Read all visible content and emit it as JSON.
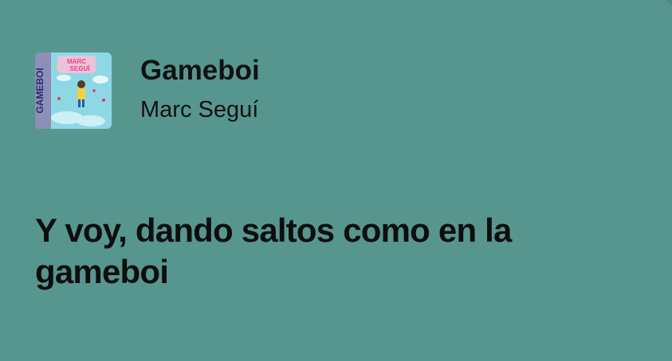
{
  "colors": {
    "background": "#57968F",
    "text": "#111111"
  },
  "track": {
    "title": "Gameboi",
    "artist": "Marc Seguí",
    "cover": {
      "spine_text": "GAMEBOI",
      "badge_text": "MARC SEGUÍ"
    }
  },
  "lyric": {
    "text": "Y voy, dando saltos como en la gameboi"
  }
}
